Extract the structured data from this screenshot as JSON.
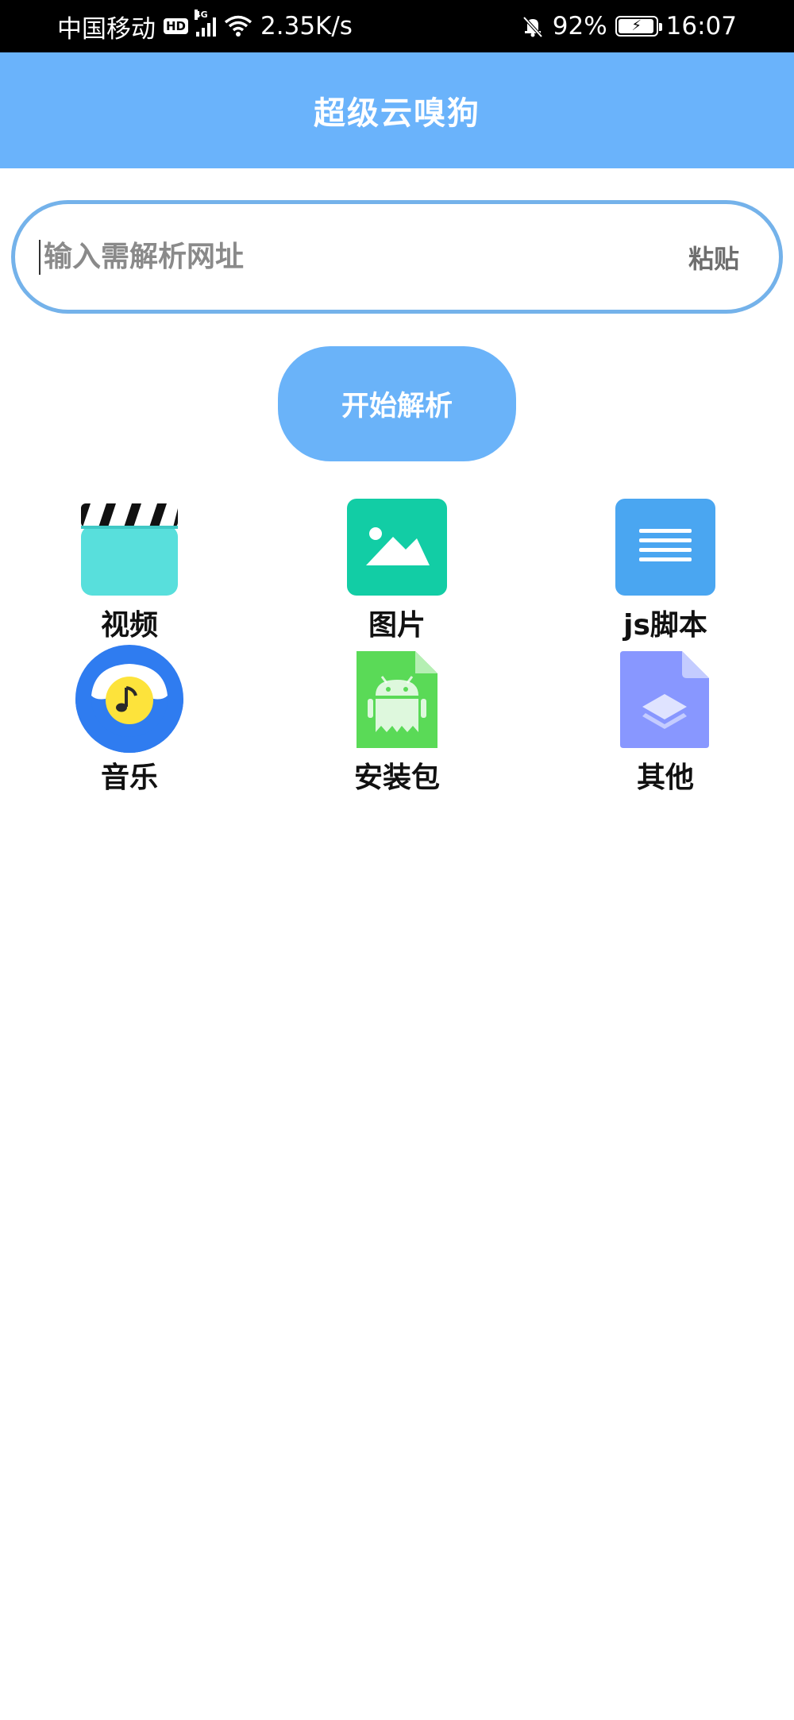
{
  "status_bar": {
    "carrier": "中国移动",
    "hd": "HD",
    "network": "4G",
    "speed": "2.35K/s",
    "battery": "92%",
    "time": "16:07"
  },
  "app_bar": {
    "title": "超级云嗅狗"
  },
  "url_box": {
    "placeholder": "输入需解析网址",
    "paste_label": "粘贴"
  },
  "parse_button": {
    "label": "开始解析"
  },
  "categories": [
    {
      "label": "视频",
      "icon": "video-clapper-icon"
    },
    {
      "label": "图片",
      "icon": "image-icon"
    },
    {
      "label": "js脚本",
      "icon": "document-lines-icon"
    },
    {
      "label": "音乐",
      "icon": "music-note-icon"
    },
    {
      "label": "安装包",
      "icon": "android-apk-icon"
    },
    {
      "label": "其他",
      "icon": "layers-file-icon"
    }
  ],
  "colors": {
    "app_bar": "#6ab3fb",
    "input_border": "#74b2ea",
    "parse_button": "#6ab3f9"
  }
}
